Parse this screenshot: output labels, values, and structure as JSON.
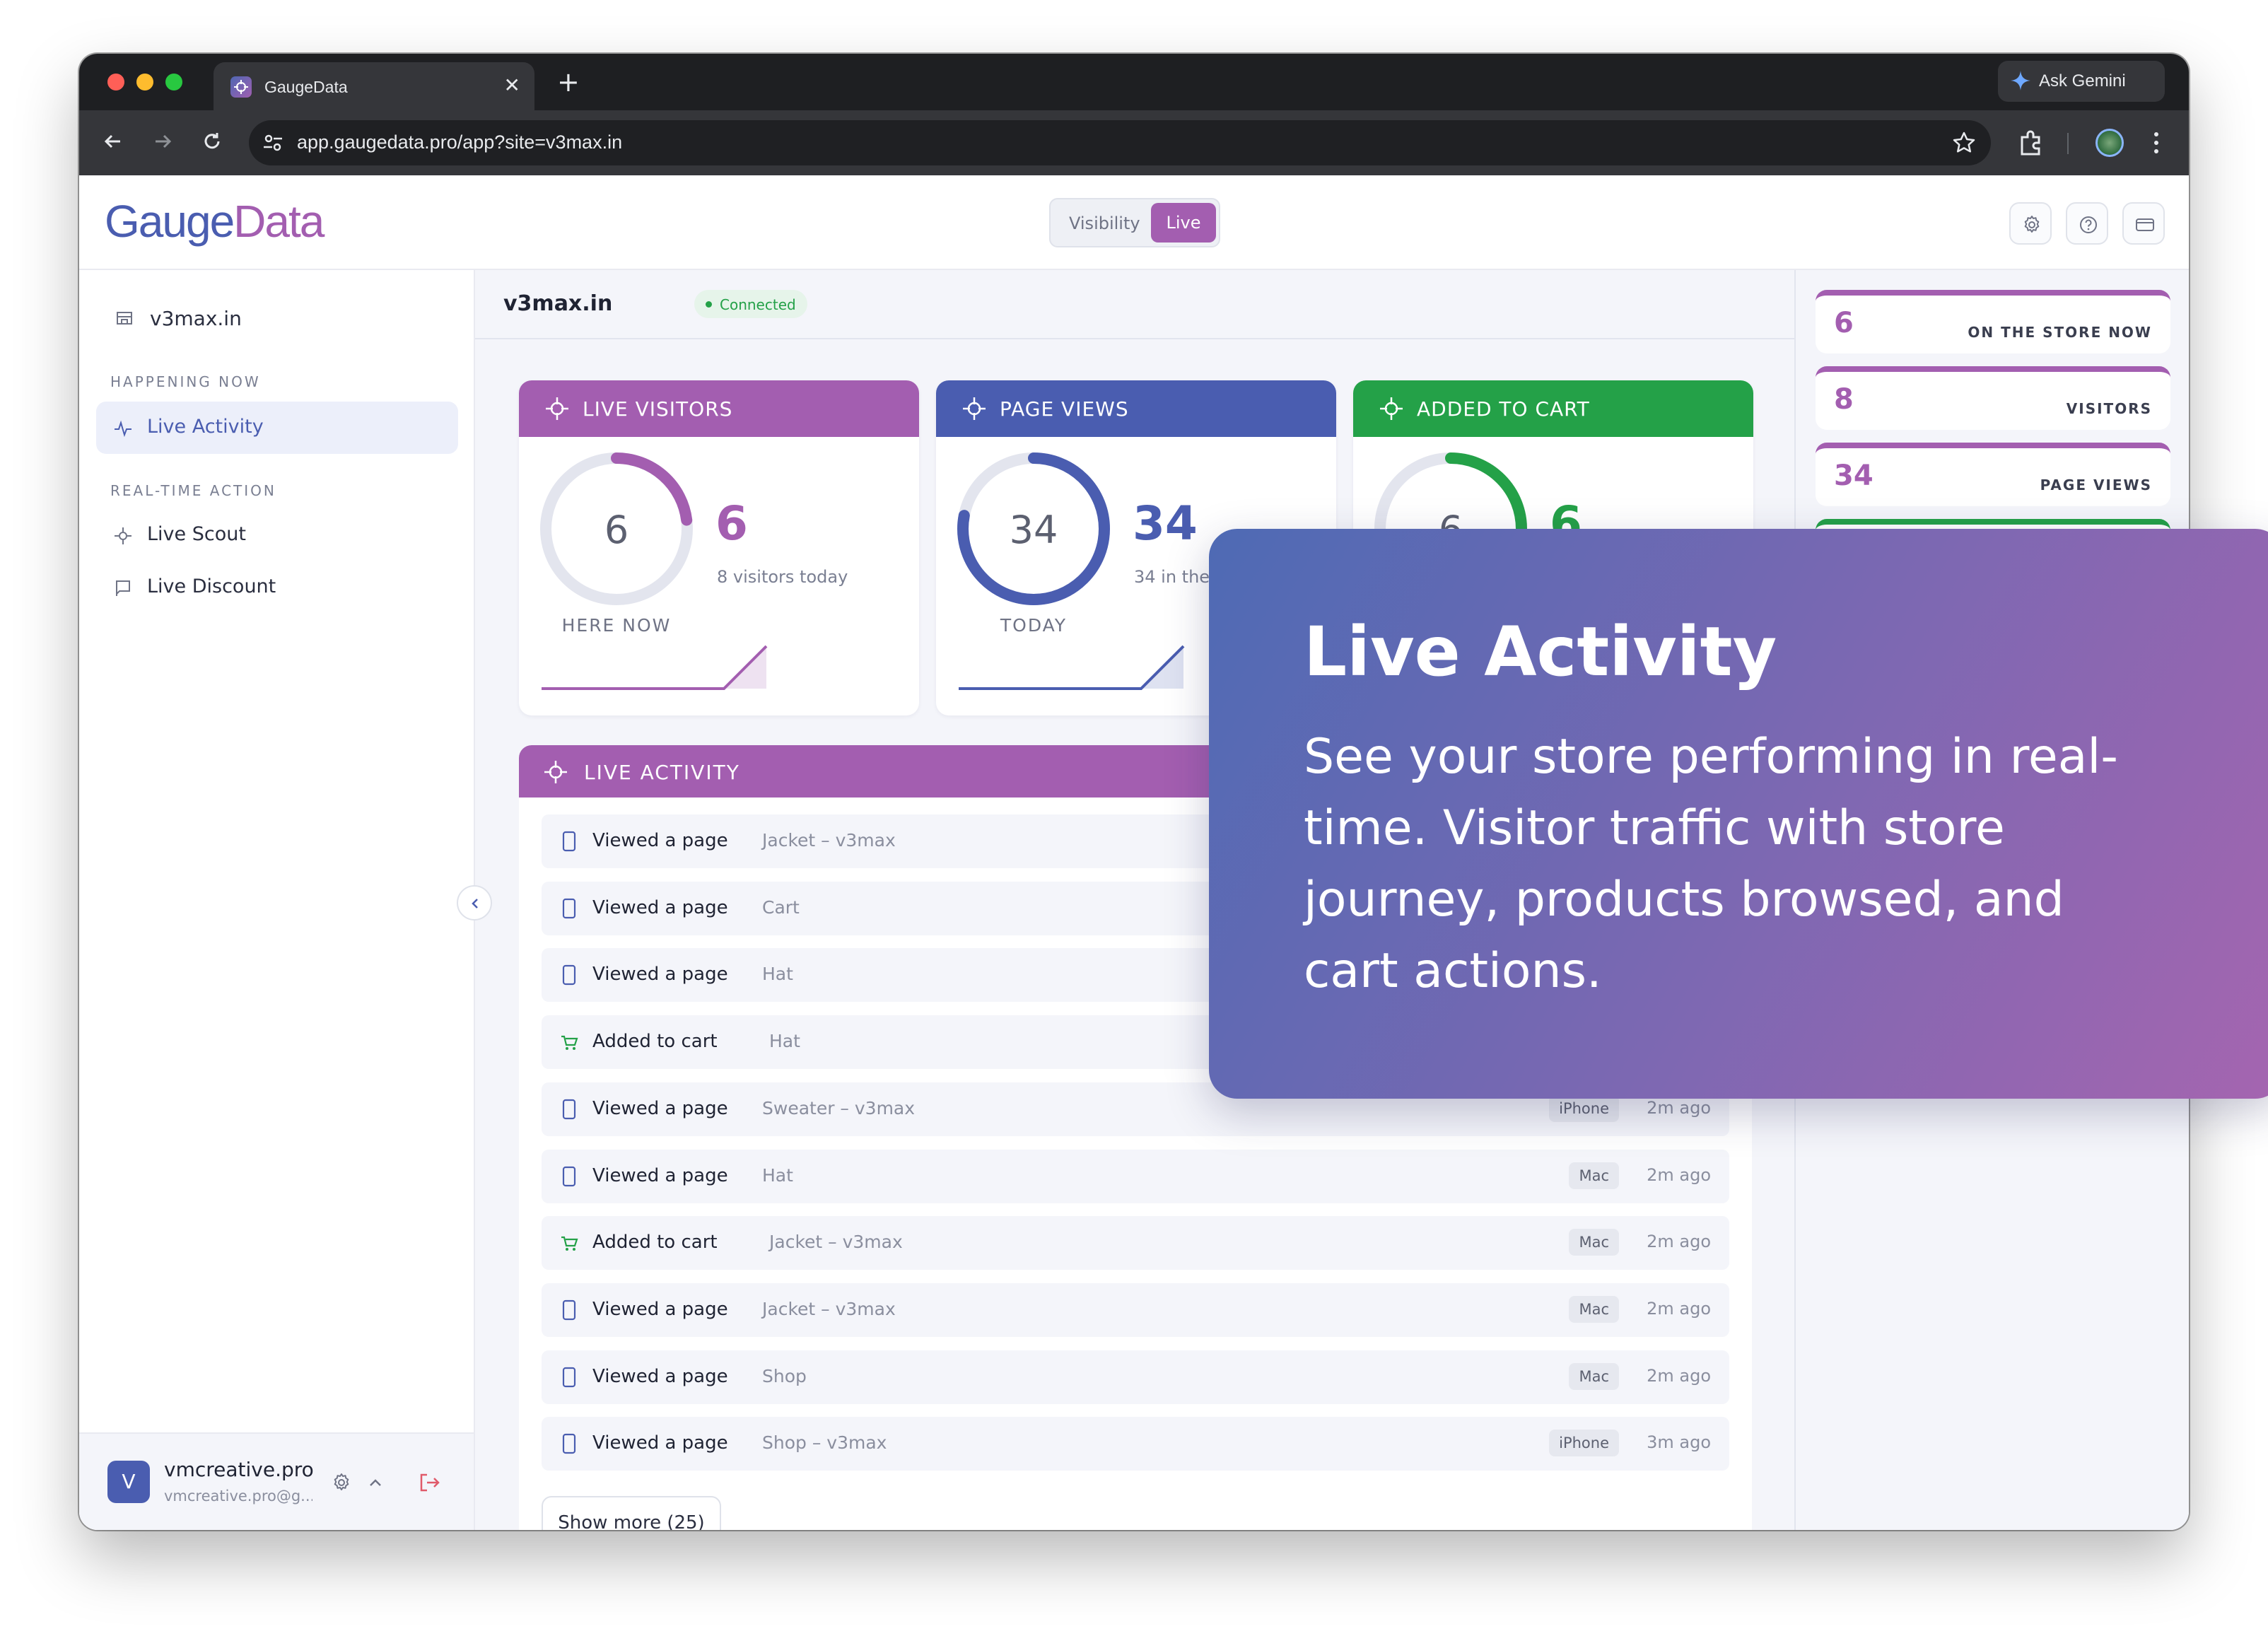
{
  "browser": {
    "tab_title": "GaugeData",
    "tab_close": "✕",
    "new_tab": "+",
    "gemini_label": "Ask Gemini",
    "url": "app.gaugedata.pro/app?site=v3max.in"
  },
  "header": {
    "logo_part1": "Gauge",
    "logo_part2": "Data",
    "toggle_visibility": "Visibility",
    "toggle_live": "Live"
  },
  "sidebar": {
    "site": "v3max.in",
    "section_happening": "HAPPENING NOW",
    "item_live_activity": "Live Activity",
    "section_realtime": "REAL-TIME ACTION",
    "item_live_scout": "Live Scout",
    "item_live_discount": "Live Discount",
    "user_name": "vmcreative.pro",
    "user_email": "vmcreative.pro@g...",
    "avatar_letter": "V"
  },
  "main": {
    "site_name": "v3max.in",
    "status": "Connected",
    "cards": [
      {
        "title": "LIVE VISITORS",
        "ring_value": "6",
        "ring_caption": "HERE NOW",
        "big_value": "6",
        "sub": "8 visitors today",
        "ring_fraction": 0.23,
        "color": "#a35eb0"
      },
      {
        "title": "PAGE VIEWS",
        "ring_value": "34",
        "ring_caption": "TODAY",
        "big_value": "34",
        "sub": "34 in the l... days",
        "ring_fraction": 0.78,
        "color": "#4a5db0"
      },
      {
        "title": "ADDED TO CART",
        "ring_value": "6",
        "ring_caption": "",
        "big_value": "6",
        "sub": "",
        "ring_fraction": 0.45,
        "color": "#24a148"
      }
    ],
    "activity": {
      "title": "LIVE ACTIVITY",
      "rows": [
        {
          "action": "Viewed a page",
          "target": "Jacket – v3max",
          "device": "",
          "ago": "",
          "type": "page"
        },
        {
          "action": "Viewed a page",
          "target": "Cart",
          "device": "",
          "ago": "",
          "type": "page"
        },
        {
          "action": "Viewed a page",
          "target": "Hat",
          "device": "",
          "ago": "",
          "type": "page"
        },
        {
          "action": "Added to cart",
          "target": "Hat",
          "device": "",
          "ago": "",
          "type": "cart"
        },
        {
          "action": "Viewed a page",
          "target": "Sweater – v3max",
          "device": "iPhone",
          "ago": "2m ago",
          "type": "page"
        },
        {
          "action": "Viewed a page",
          "target": "Hat",
          "device": "Mac",
          "ago": "2m ago",
          "type": "page"
        },
        {
          "action": "Added to cart",
          "target": "Jacket – v3max",
          "device": "Mac",
          "ago": "2m ago",
          "type": "cart"
        },
        {
          "action": "Viewed a page",
          "target": "Jacket – v3max",
          "device": "Mac",
          "ago": "2m ago",
          "type": "page"
        },
        {
          "action": "Viewed a page",
          "target": "Shop",
          "device": "Mac",
          "ago": "2m ago",
          "type": "page"
        },
        {
          "action": "Viewed a page",
          "target": "Shop – v3max",
          "device": "iPhone",
          "ago": "3m ago",
          "type": "page"
        }
      ],
      "show_more": "Show more (25)"
    }
  },
  "right_panel": {
    "stats": [
      {
        "value": "6",
        "label": "ON THE STORE NOW"
      },
      {
        "value": "8",
        "label": "VISITORS"
      },
      {
        "value": "34",
        "label": "PAGE VIEWS"
      }
    ]
  },
  "overlay": {
    "title": "Live Activity",
    "body": "See your store performing in real-time. Visitor traffic with store journey, products browsed, and cart actions."
  },
  "colors": {
    "purple": "#a35eb0",
    "blue": "#4a5db0",
    "green": "#24a148"
  }
}
